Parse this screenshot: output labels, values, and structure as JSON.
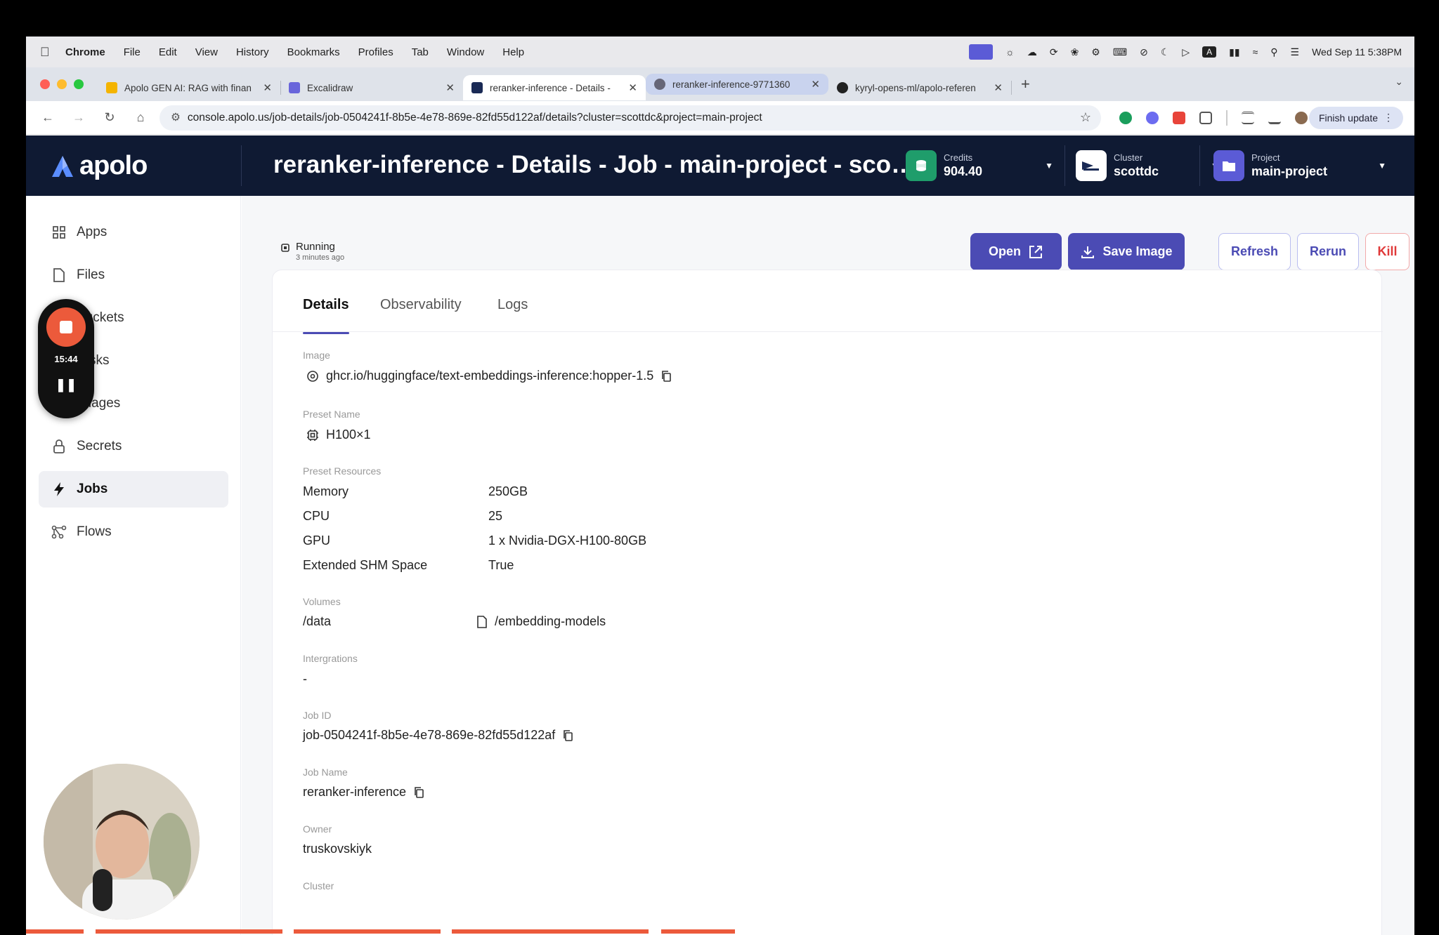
{
  "menubar": {
    "app": "Chrome",
    "items": [
      "File",
      "Edit",
      "View",
      "History",
      "Bookmarks",
      "Profiles",
      "Tab",
      "Window",
      "Help"
    ],
    "datetime": "Wed Sep 11  5:38PM"
  },
  "browser": {
    "tabs": [
      {
        "title": "Apolo GEN AI: RAG with finan"
      },
      {
        "title": "Excalidraw"
      },
      {
        "title": "reranker-inference - Details -"
      },
      {
        "title": "reranker-inference-9771360"
      },
      {
        "title": "kyryl-opens-ml/apolo-referen"
      }
    ],
    "url": "console.apolo.us/job-details/job-0504241f-8b5e-4e78-869e-82fd55d122af/details?cluster=scottdc&project=main-project",
    "finish_update": "Finish update"
  },
  "header": {
    "logo_text": "apolo",
    "page_title": "reranker-inference - Details - Job - main-project - scottdc",
    "credits_label": "Credits",
    "credits_value": "904.40",
    "cluster_label": "Cluster",
    "cluster_value": "scottdc",
    "project_label": "Project",
    "project_value": "main-project"
  },
  "sidebar": {
    "items": [
      {
        "label": "Apps"
      },
      {
        "label": "Files"
      },
      {
        "label": "Buckets"
      },
      {
        "label": "Disks"
      },
      {
        "label": "Images"
      },
      {
        "label": "Secrets"
      },
      {
        "label": "Jobs"
      },
      {
        "label": "Flows"
      }
    ]
  },
  "recorder": {
    "time": "15:44"
  },
  "job": {
    "status": "Running",
    "status_time": "3 minutes ago",
    "buttons": {
      "open": "Open",
      "save_image": "Save Image",
      "refresh": "Refresh",
      "rerun": "Rerun",
      "kill": "Kill"
    },
    "tabs": [
      "Details",
      "Observability",
      "Logs"
    ],
    "image_label": "Image",
    "image_value": "ghcr.io/huggingface/text-embeddings-inference:hopper-1.5",
    "preset_name_label": "Preset Name",
    "preset_name_value": "H100×1",
    "preset_resources_label": "Preset Resources",
    "resources": [
      {
        "key": "Memory",
        "value": "250GB"
      },
      {
        "key": "CPU",
        "value": "25"
      },
      {
        "key": "GPU",
        "value": "1 x Nvidia-DGX-H100-80GB"
      },
      {
        "key": "Extended SHM Space",
        "value": "True"
      }
    ],
    "volumes_label": "Volumes",
    "volume_mount": "/data",
    "volume_path": "/embedding-models",
    "integrations_label": "Intergrations",
    "integrations_value": "-",
    "job_id_label": "Job ID",
    "job_id_value": "job-0504241f-8b5e-4e78-869e-82fd55d122af",
    "job_name_label": "Job Name",
    "job_name_value": "reranker-inference",
    "owner_label": "Owner",
    "owner_value": "truskovskiyk",
    "cluster_label": "Cluster"
  },
  "colors": {
    "accent": "#4b4bb4",
    "header_bg": "#0f1a33",
    "credits": "#1f9d6b",
    "danger": "#e03a3a",
    "recorder": "#ec5a3b"
  }
}
